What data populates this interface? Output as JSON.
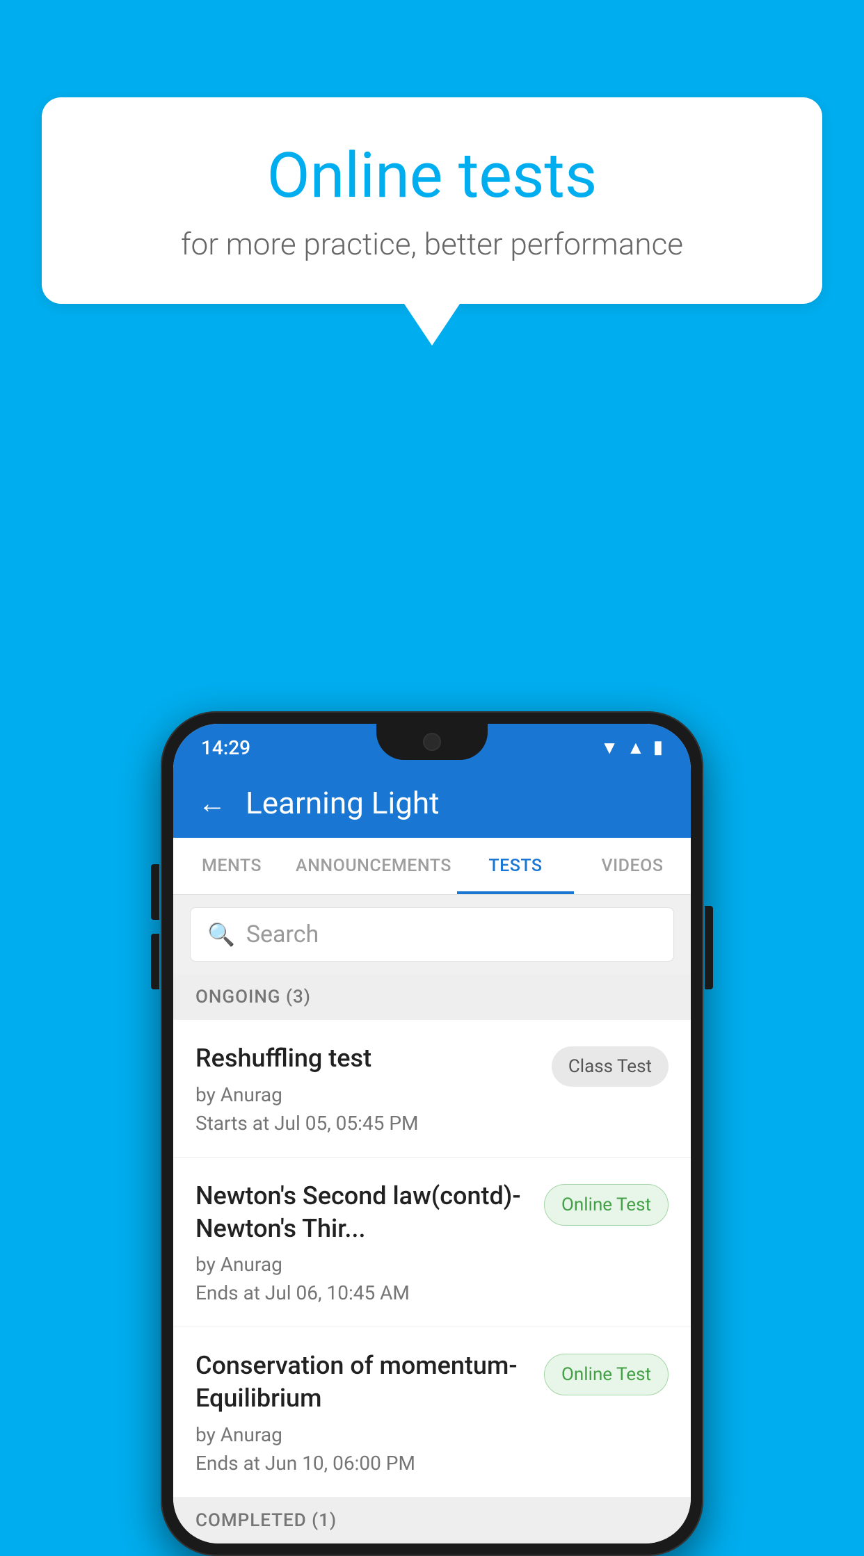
{
  "background_color": "#00AEEF",
  "bubble": {
    "title": "Online tests",
    "subtitle": "for more practice, better performance"
  },
  "status_bar": {
    "time": "14:29",
    "icons": [
      "wifi",
      "signal",
      "battery"
    ]
  },
  "header": {
    "title": "Learning Light",
    "back_label": "←"
  },
  "tabs": [
    {
      "label": "MENTS",
      "active": false
    },
    {
      "label": "ANNOUNCEMENTS",
      "active": false
    },
    {
      "label": "TESTS",
      "active": true
    },
    {
      "label": "VIDEOS",
      "active": false
    }
  ],
  "search": {
    "placeholder": "Search"
  },
  "ongoing_section": {
    "label": "ONGOING (3)"
  },
  "tests": [
    {
      "name": "Reshuffling test",
      "author": "by Anurag",
      "time": "Starts at  Jul 05, 05:45 PM",
      "badge": "Class Test",
      "badge_type": "class"
    },
    {
      "name": "Newton's Second law(contd)-Newton's Thir...",
      "author": "by Anurag",
      "time": "Ends at  Jul 06, 10:45 AM",
      "badge": "Online Test",
      "badge_type": "online"
    },
    {
      "name": "Conservation of momentum-Equilibrium",
      "author": "by Anurag",
      "time": "Ends at  Jun 10, 06:00 PM",
      "badge": "Online Test",
      "badge_type": "online"
    }
  ],
  "completed_section": {
    "label": "COMPLETED (1)"
  }
}
